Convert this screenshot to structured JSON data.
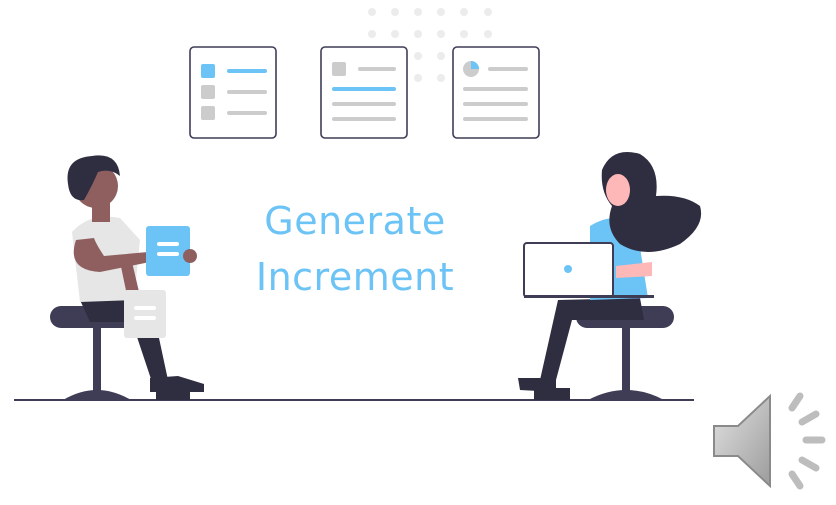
{
  "headline": {
    "line1": "Generate",
    "line2": "Increment"
  },
  "colors": {
    "accent": "#6cc3f5",
    "dark": "#2f2e41",
    "card_border": "#3f3d56",
    "gray": "#cccccc",
    "skin_dark": "#8f5f5f",
    "skin_light": "#ffb8b8",
    "shirt_gray": "#e6e6e6"
  },
  "icons": [
    "card-list-icon",
    "card-document-icon",
    "card-pie-chart-icon",
    "audio-speaker-icon"
  ]
}
